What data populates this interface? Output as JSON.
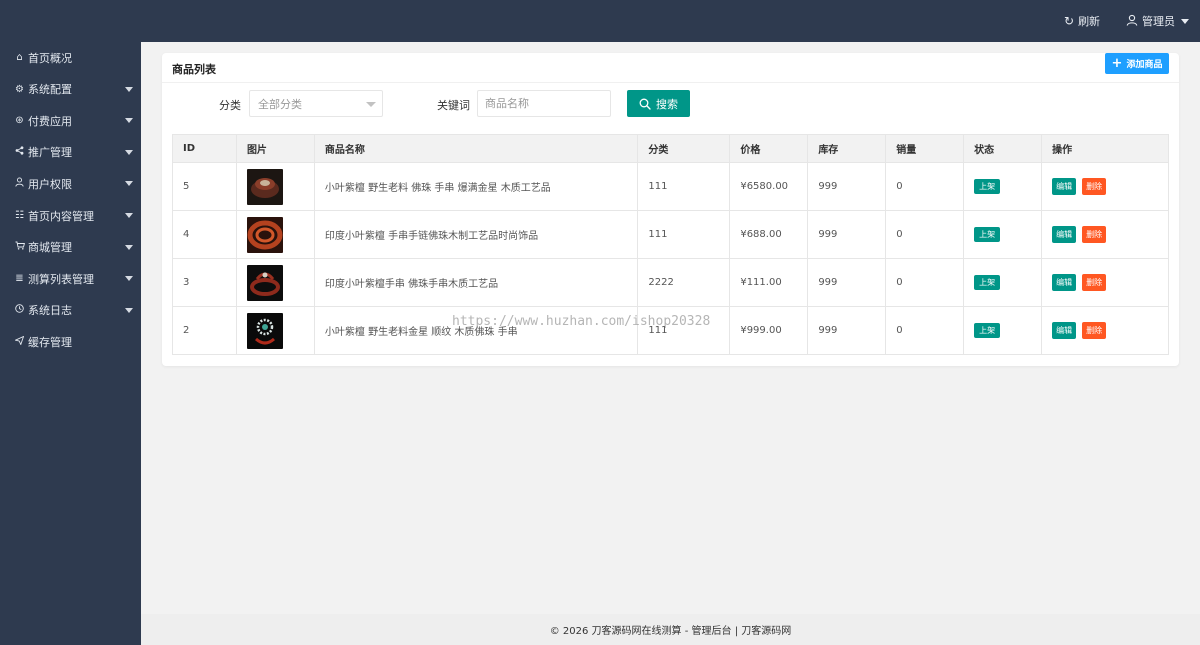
{
  "header": {
    "refresh_label": "刷新",
    "user_label": "管理员"
  },
  "sidebar": {
    "items": [
      {
        "label": "首页概况",
        "icon": "home-icon",
        "has_caret": false
      },
      {
        "label": "系统配置",
        "icon": "gear-icon",
        "has_caret": true
      },
      {
        "label": "付费应用",
        "icon": "circle-icon",
        "has_caret": true
      },
      {
        "label": "推广管理",
        "icon": "share-icon",
        "has_caret": true
      },
      {
        "label": "用户权限",
        "icon": "user-icon",
        "has_caret": true
      },
      {
        "label": "首页内容管理",
        "icon": "content-icon",
        "has_caret": true
      },
      {
        "label": "商城管理",
        "icon": "cart-icon",
        "has_caret": true
      },
      {
        "label": "测算列表管理",
        "icon": "list-icon",
        "has_caret": true
      },
      {
        "label": "系统日志",
        "icon": "clock-icon",
        "has_caret": true
      },
      {
        "label": "缓存管理",
        "icon": "send-icon",
        "has_caret": false
      }
    ]
  },
  "card": {
    "title": "商品列表",
    "add_label": "添加商品"
  },
  "filters": {
    "category_label": "分类",
    "category_value": "全部分类",
    "keyword_label": "关键词",
    "keyword_placeholder": "商品名称",
    "search_label": "搜索"
  },
  "table": {
    "columns": [
      "ID",
      "图片",
      "商品名称",
      "分类",
      "价格",
      "库存",
      "销量",
      "状态",
      "操作"
    ],
    "rows": [
      {
        "id": "5",
        "name": "小叶紫檀 野生老料 佛珠 手串 爆满金星 木质工艺品",
        "category": "111",
        "price": "¥6580.00",
        "stock": "999",
        "sales": "0",
        "status": "上架"
      },
      {
        "id": "4",
        "name": "印度小叶紫檀 手串手链佛珠木制工艺品时尚饰品",
        "category": "111",
        "price": "¥688.00",
        "stock": "999",
        "sales": "0",
        "status": "上架"
      },
      {
        "id": "3",
        "name": "印度小叶紫檀手串 佛珠手串木质工艺品",
        "category": "2222",
        "price": "¥111.00",
        "stock": "999",
        "sales": "0",
        "status": "上架"
      },
      {
        "id": "2",
        "name": "小叶紫檀 野生老料金星 顺纹 木质佛珠 手串",
        "category": "111",
        "price": "¥999.00",
        "stock": "999",
        "sales": "0",
        "status": "上架"
      }
    ],
    "edit_label": "编辑",
    "delete_label": "删除"
  },
  "watermark": "https://www.huzhan.com/ishop20328",
  "footer": "© 2026 刀客源码网在线测算 - 管理后台 | 刀客源码网",
  "colors": {
    "nav_bg": "#2e3a4f",
    "primary_green": "#009688",
    "primary_blue": "#1e9fff",
    "danger_orange": "#ff5722"
  }
}
